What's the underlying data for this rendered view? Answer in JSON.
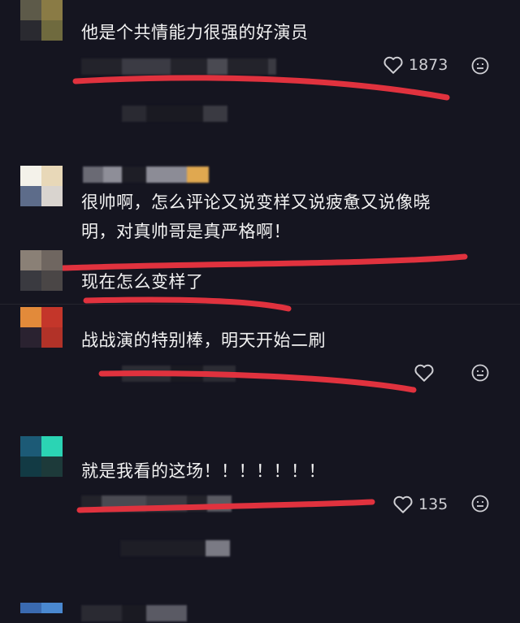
{
  "comments": [
    {
      "text": "他是个共情能力很强的好演员",
      "likes": "1873"
    },
    {
      "text_line1": "很帅啊，怎么评论又说变样又说疲惫又说像晓",
      "text_line2": "明，对真帅哥是真严格啊！"
    },
    {
      "text": "现在怎么变样了"
    },
    {
      "text": "战战演的特别棒，明天开始二刷"
    },
    {
      "text": "就是我看的这场！！！！！！！",
      "likes": "135"
    }
  ],
  "icons": {
    "like": "heart-outline-icon",
    "react": "emoji-face-icon"
  },
  "colors": {
    "background": "#151520",
    "underline": "#e0323e",
    "icon": "#cfcfd4"
  }
}
